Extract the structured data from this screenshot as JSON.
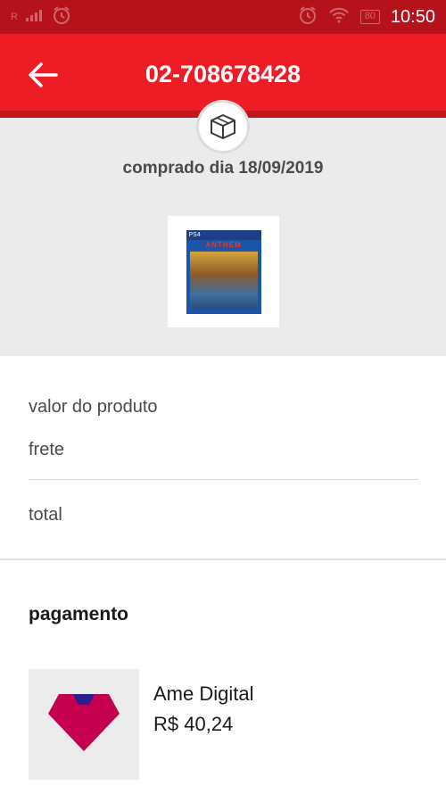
{
  "status_bar": {
    "time": "10:50",
    "battery": "80",
    "carrier_glyph": "R",
    "colors": {
      "background": "#b5121b"
    }
  },
  "app_bar": {
    "title": "02-708678428",
    "back_icon": "arrow-left-icon",
    "colors": {
      "background": "#ee1c25"
    }
  },
  "order": {
    "badge_icon": "package-box-icon",
    "purchased_on": "comprado dia 18/09/2019",
    "product_image": {
      "platform": "PS4",
      "name": "ANTHEM"
    }
  },
  "summary": {
    "rows": [
      {
        "label": "valor do produto"
      },
      {
        "label": "frete"
      },
      {
        "label": "total"
      }
    ]
  },
  "payment": {
    "section_title": "pagamento",
    "method_icon": "ame-digital-logo-icon",
    "method_name": "Ame Digital",
    "amount": "R$ 40,24",
    "colors": {
      "logo_primary": "#c4004f",
      "logo_accent": "#2a1f8f"
    }
  }
}
